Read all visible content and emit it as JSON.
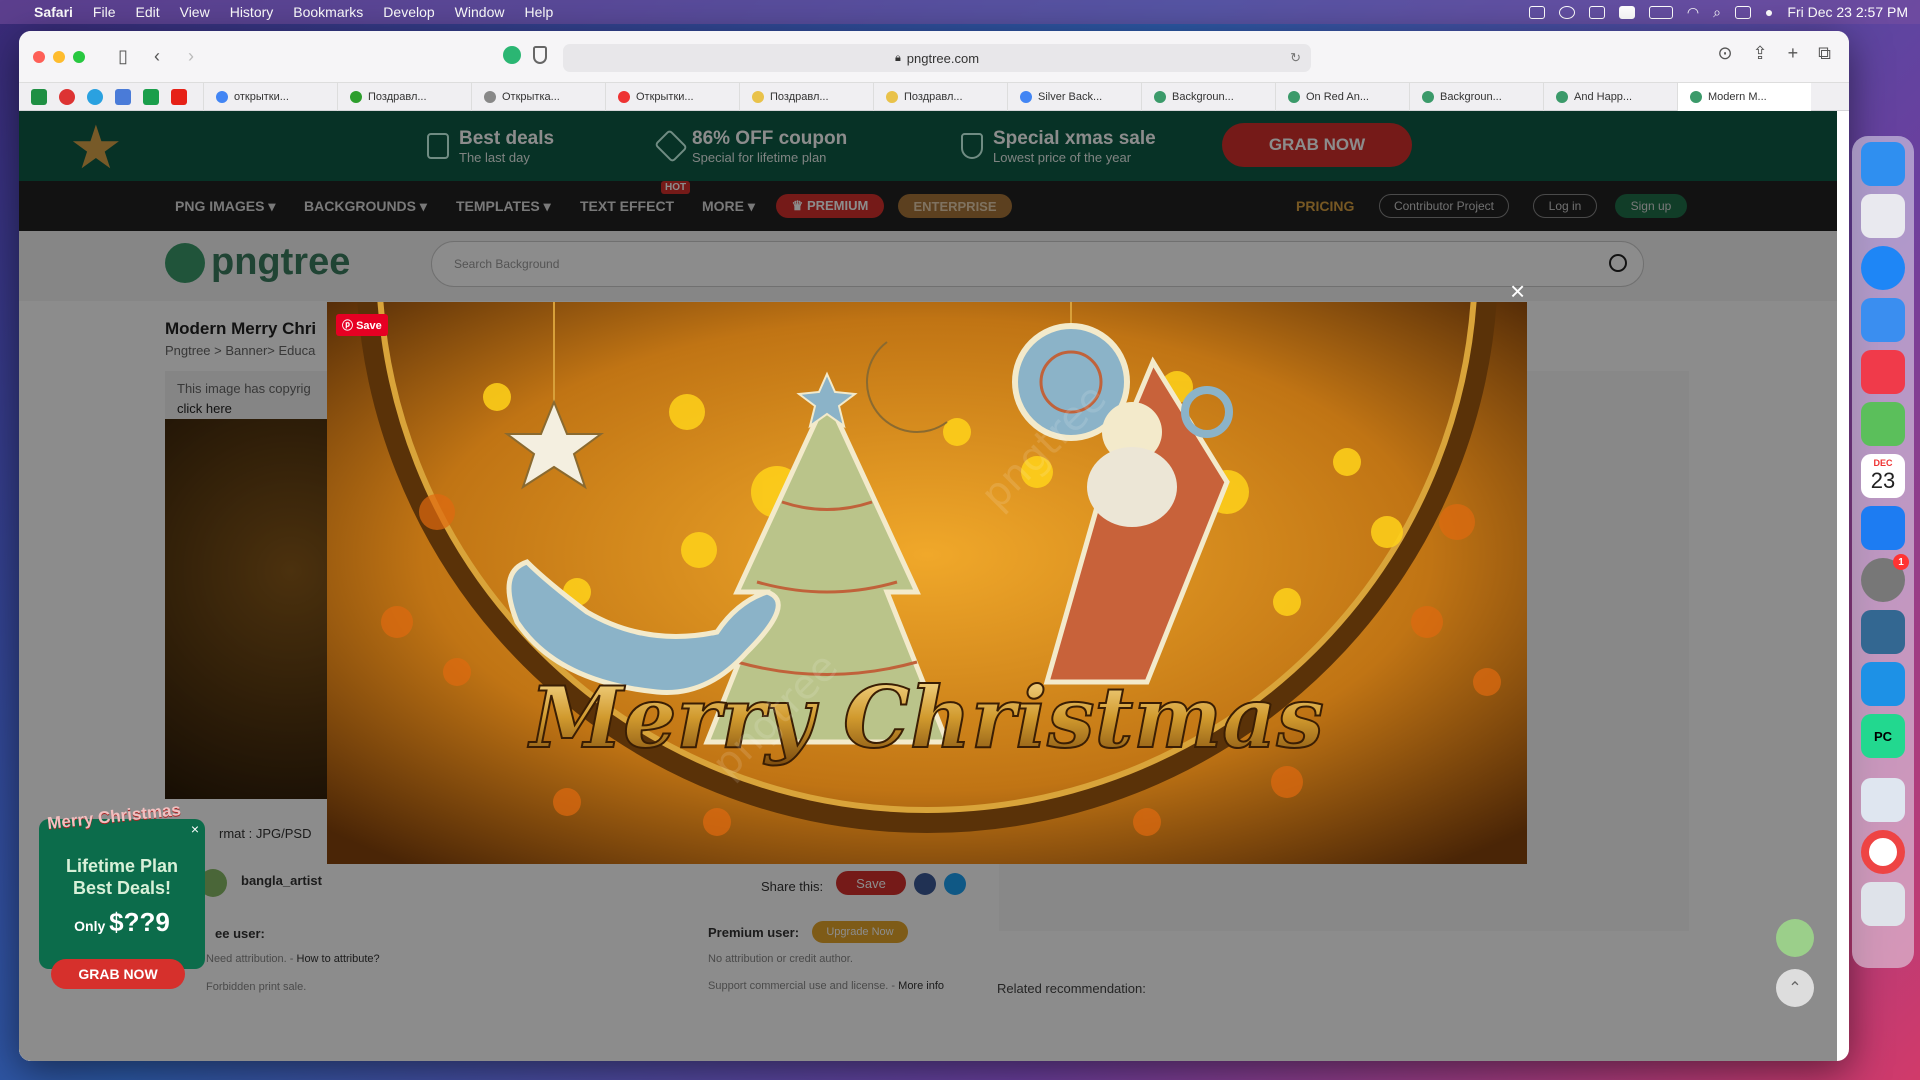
{
  "menubar": {
    "app": "Safari",
    "items": [
      "File",
      "Edit",
      "View",
      "History",
      "Bookmarks",
      "Develop",
      "Window",
      "Help"
    ],
    "clock": "Fri Dec 23  2:57 PM"
  },
  "browser": {
    "url": "pngtree.com",
    "tabs": [
      "открытки...",
      "Поздравл...",
      "Открытка...",
      "Открытки...",
      "Поздравл...",
      "Поздравл...",
      "Silver Back...",
      "Backgroun...",
      "On Red An...",
      "Backgroun...",
      "And Happ...",
      "Modern M..."
    ]
  },
  "promo": {
    "deal1_title": "Best deals",
    "deal1_sub": "The last day",
    "deal2_title": "86% OFF coupon",
    "deal2_sub": "Special for lifetime plan",
    "deal3_title": "Special xmas sale",
    "deal3_sub": "Lowest price of the year",
    "grab": "GRAB NOW"
  },
  "nav": {
    "png": "PNG IMAGES ▾",
    "bg": "BACKGROUNDS ▾",
    "tpl": "TEMPLATES ▾",
    "text": "TEXT EFFECT",
    "hot": "HOT",
    "more": "MORE ▾",
    "premium": "♛ PREMIUM",
    "enterprise": "ENTERPRISE",
    "pricing": "PRICING",
    "contrib": "Contributor Project",
    "login": "Log in",
    "signup": "Sign up"
  },
  "search": {
    "logo": "pngtree",
    "placeholder": "Search Background"
  },
  "detail": {
    "title": "Modern Merry Chri",
    "crumb": "Pngtree > Banner> Educa",
    "copy1": "This image has copyrig",
    "copy2": "click here",
    "format": "rmat : JPG/PSD",
    "author": "bangla_artist",
    "share": "Share this:",
    "save": "Save",
    "free_user": "ee user:",
    "free1": "Need attribution. -",
    "free1_link": "How to attribute?",
    "free2": "Forbidden print sale.",
    "prem_user": "Premium user:",
    "upgrade": "Upgrade Now",
    "prem1": "No attribution or credit author.",
    "prem2": "Support commercial use and license. -",
    "prem2_link": "More info",
    "related": "Related recommendation:"
  },
  "modal": {
    "save": "Save",
    "close": "×",
    "banner_text": "Merry Christmas"
  },
  "mini_promo": {
    "headline": "Merry Christmas",
    "line1": "Lifetime Plan",
    "line2": "Best Deals!",
    "only": "Only",
    "price": "$??9",
    "grab": "GRAB NOW"
  },
  "dock": {
    "calendar_month": "DEC",
    "calendar_day": "23",
    "settings_badge": "1"
  }
}
